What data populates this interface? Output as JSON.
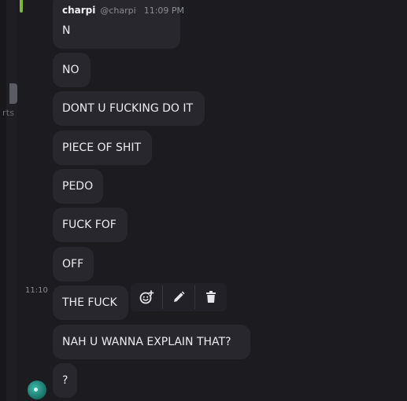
{
  "sidebar": {
    "partial_label": "rts"
  },
  "message_group": {
    "author": "charpi",
    "handle": "@charpi",
    "time": "11:09 PM",
    "hover_time": "11:10"
  },
  "messages": [
    {
      "text": "N"
    },
    {
      "text": "NO"
    },
    {
      "text": "DONT U FUCKING DO IT"
    },
    {
      "text": "PIECE OF SHIT"
    },
    {
      "text": "PEDO"
    },
    {
      "text": "FUCK FOF"
    },
    {
      "text": "OFF"
    },
    {
      "text": "THE FUCK"
    },
    {
      "text": "NAH U WANNA EXPLAIN THAT?"
    },
    {
      "text": "?"
    }
  ],
  "actions": {
    "add_reaction_icon": "add-reaction-icon",
    "edit_icon": "pencil-icon",
    "delete_icon": "trash-icon"
  },
  "colors": {
    "background": "#1c1b20",
    "bubble": "#28272d",
    "accent": "#7db63b",
    "text": "#ececf0",
    "muted": "#8c8c95"
  }
}
